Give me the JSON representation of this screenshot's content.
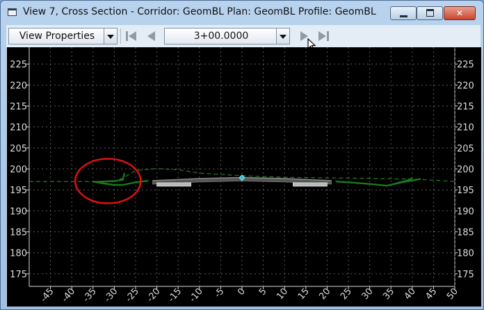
{
  "window": {
    "title": "View 7, Cross Section - Corridor: GeomBL Plan: GeomBL Profile: GeomBL",
    "icons": [
      "window-icon",
      "minimize-icon",
      "maximize-icon",
      "close-icon"
    ]
  },
  "toolbar": {
    "view_properties_label": "View Properties",
    "station_value": "3+00.0000",
    "nav_icons": [
      "first-icon",
      "previous-icon",
      "next-icon",
      "last-icon"
    ]
  },
  "chart_data": {
    "type": "line",
    "y_ticks": [
      "225",
      "220",
      "215",
      "210",
      "205",
      "200",
      "195",
      "190",
      "185",
      "180",
      "175"
    ],
    "x_ticks": [
      "-45",
      "-40",
      "-35",
      "-30",
      "-25",
      "-20",
      "-15",
      "-10",
      "-5",
      "0",
      "5",
      "10",
      "15",
      "20",
      "25",
      "30",
      "35",
      "40",
      "45",
      "50"
    ],
    "xlim": [
      -50,
      50
    ],
    "ylim": [
      172,
      229
    ],
    "grid": true,
    "colors": {
      "background": "#000000",
      "grid": "#5a5a5a",
      "ground_line": "#2a7a2a",
      "template": "#1a7a1a",
      "pavement": "#555555",
      "curb": "#b8b8b8",
      "centerline_point": "#2ec4d8",
      "annotation_circle": "#e01010",
      "tick_text": "#dddddd"
    },
    "series": [
      {
        "style": "dashed",
        "points": [
          [
            -50,
            197
          ],
          [
            -30,
            197
          ],
          [
            -28,
            197.8
          ],
          [
            -25,
            199.6
          ],
          [
            -20,
            200.1
          ],
          [
            -15,
            199.8
          ],
          [
            -10,
            199.0
          ],
          [
            0,
            198.4
          ],
          [
            10,
            198.0
          ],
          [
            25,
            197.8
          ],
          [
            40,
            197.6
          ],
          [
            50,
            197.0
          ]
        ]
      },
      {
        "style": "solid",
        "points": [
          [
            -35,
            197.0
          ],
          [
            -33,
            196.6
          ],
          [
            -30,
            196.2
          ],
          [
            -28,
            196.2
          ],
          [
            -25,
            196.8
          ],
          [
            -22,
            197.2
          ]
        ]
      },
      {
        "style": "solid",
        "points": [
          [
            -35,
            196.9
          ],
          [
            -30,
            197.1
          ],
          [
            -28,
            197.4
          ],
          [
            -27.6,
            199.0
          ]
        ]
      },
      {
        "style": "solid",
        "points": [
          [
            22,
            197.0
          ],
          [
            25,
            196.8
          ],
          [
            30,
            196.4
          ],
          [
            34,
            196.0
          ],
          [
            38,
            196.9
          ],
          [
            42,
            197.6
          ]
        ]
      },
      {
        "style": "solid",
        "points": [
          [
            36,
            196.5
          ],
          [
            39,
            197.3
          ],
          [
            40,
            197.8
          ]
        ]
      }
    ],
    "pavement": [
      [
        -21,
        197.2
      ],
      [
        -10,
        197.7
      ],
      [
        0,
        197.95
      ],
      [
        10,
        197.7
      ],
      [
        21,
        197.2
      ]
    ],
    "curbs": [
      [
        -20,
        -12
      ],
      [
        12,
        20
      ]
    ],
    "centerline_point": [
      0,
      197.9
    ],
    "annotation": {
      "shape": "circle",
      "center": [
        -31.5,
        197.1
      ],
      "radius_x": 7.7,
      "radius_y": 5.3
    }
  }
}
